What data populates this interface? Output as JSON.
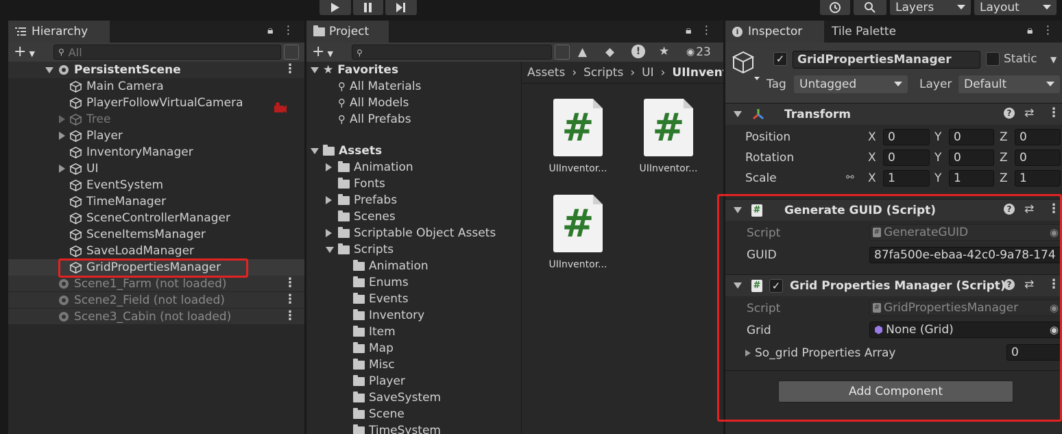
{
  "toolbar": {
    "play_icon": "play-icon",
    "pause_icon": "pause-icon",
    "step_icon": "step-icon",
    "layers_label": "Layers",
    "layout_label": "Layout"
  },
  "hierarchy": {
    "tab_label": "Hierarchy",
    "search_placeholder": "All",
    "scene_name": "PersistentScene",
    "items": [
      {
        "label": "Main Camera",
        "dim": false,
        "expandable": false
      },
      {
        "label": "PlayerFollowVirtualCamera",
        "dim": false,
        "expandable": false
      },
      {
        "label": "Tree",
        "dim": true,
        "expandable": true
      },
      {
        "label": "Player",
        "dim": false,
        "expandable": true
      },
      {
        "label": "InventoryManager",
        "dim": false,
        "expandable": false
      },
      {
        "label": "UI",
        "dim": false,
        "expandable": true
      },
      {
        "label": "EventSystem",
        "dim": false,
        "expandable": false
      },
      {
        "label": "TimeManager",
        "dim": false,
        "expandable": false
      },
      {
        "label": "SceneControllerManager",
        "dim": false,
        "expandable": false
      },
      {
        "label": "SceneItemsManager",
        "dim": false,
        "expandable": false
      },
      {
        "label": "SaveLoadManager",
        "dim": false,
        "expandable": false
      },
      {
        "label": "GridPropertiesManager",
        "dim": false,
        "expandable": false,
        "selected": true
      }
    ],
    "unloaded_scenes": [
      "Scene1_Farm (not loaded)",
      "Scene2_Field (not loaded)",
      "Scene3_Cabin (not loaded)"
    ]
  },
  "project": {
    "tab_label": "Project",
    "visible_count": "23",
    "favorites_label": "Favorites",
    "favorites": [
      "All Materials",
      "All Models",
      "All Prefabs"
    ],
    "assets_label": "Assets",
    "asset_folders": [
      {
        "label": "Animation",
        "expandable": true
      },
      {
        "label": "Fonts",
        "expandable": false
      },
      {
        "label": "Prefabs",
        "expandable": true
      },
      {
        "label": "Scenes",
        "expandable": false
      },
      {
        "label": "Scriptable Object Assets",
        "expandable": true
      },
      {
        "label": "Scripts",
        "expandable": true,
        "expanded": true
      }
    ],
    "script_folders": [
      "Animation",
      "Enums",
      "Events",
      "Inventory",
      "Item",
      "Map",
      "Misc",
      "Player",
      "SaveSystem",
      "Scene",
      "TimeSystem"
    ],
    "breadcrumb": [
      "Assets",
      "Scripts",
      "UI",
      "UIInvent"
    ],
    "files": [
      "UIInventor...",
      "UIInventor...",
      "UIInventor..."
    ]
  },
  "inspector": {
    "tab_label": "Inspector",
    "tab2_label": "Tile Palette",
    "object_name": "GridPropertiesManager",
    "static_label": "Static",
    "tag_label": "Tag",
    "tag_value": "Untagged",
    "layer_label": "Layer",
    "layer_value": "Default",
    "transform": {
      "title": "Transform",
      "rows": [
        {
          "label": "Position",
          "x": "0",
          "y": "0",
          "z": "0"
        },
        {
          "label": "Rotation",
          "x": "0",
          "y": "0",
          "z": "0"
        },
        {
          "label": "Scale",
          "x": "1",
          "y": "1",
          "z": "1"
        }
      ]
    },
    "generate_guid": {
      "title": "Generate GUID (Script)",
      "script_label": "Script",
      "script_value": "GenerateGUID",
      "guid_label": "GUID",
      "guid_value": "87fa500e-ebaa-42c0-9a78-174"
    },
    "grid_props": {
      "title": "Grid Properties Manager (Script)",
      "script_label": "Script",
      "script_value": "GridPropertiesManager",
      "grid_label": "Grid",
      "grid_value": "None (Grid)",
      "array_label": "So_grid Properties Array",
      "array_value": "0"
    },
    "add_component": "Add Component"
  },
  "colors": {
    "highlight": "#e52222",
    "script_green": "#2d7a2d"
  }
}
